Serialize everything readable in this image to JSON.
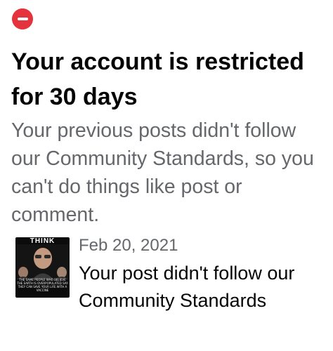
{
  "notice": {
    "icon": "restricted-icon",
    "accent_color": "#e4333c",
    "title": "Your account is restricted for 30 days",
    "description": "Your previous posts didn't follow our Community Standards, so you can't do things like post or comment."
  },
  "post": {
    "thumbnail": {
      "headline": "THINK",
      "caption": "THE SAME PEOPLE WHO BELIEVE THE EARTH IS OVERPOPULATED SAY THEY CAN SAVE YOUR LIFE WITH A VACCINE"
    },
    "date": "Feb 20, 2021",
    "message": "Your post didn't follow our Community Standards"
  }
}
